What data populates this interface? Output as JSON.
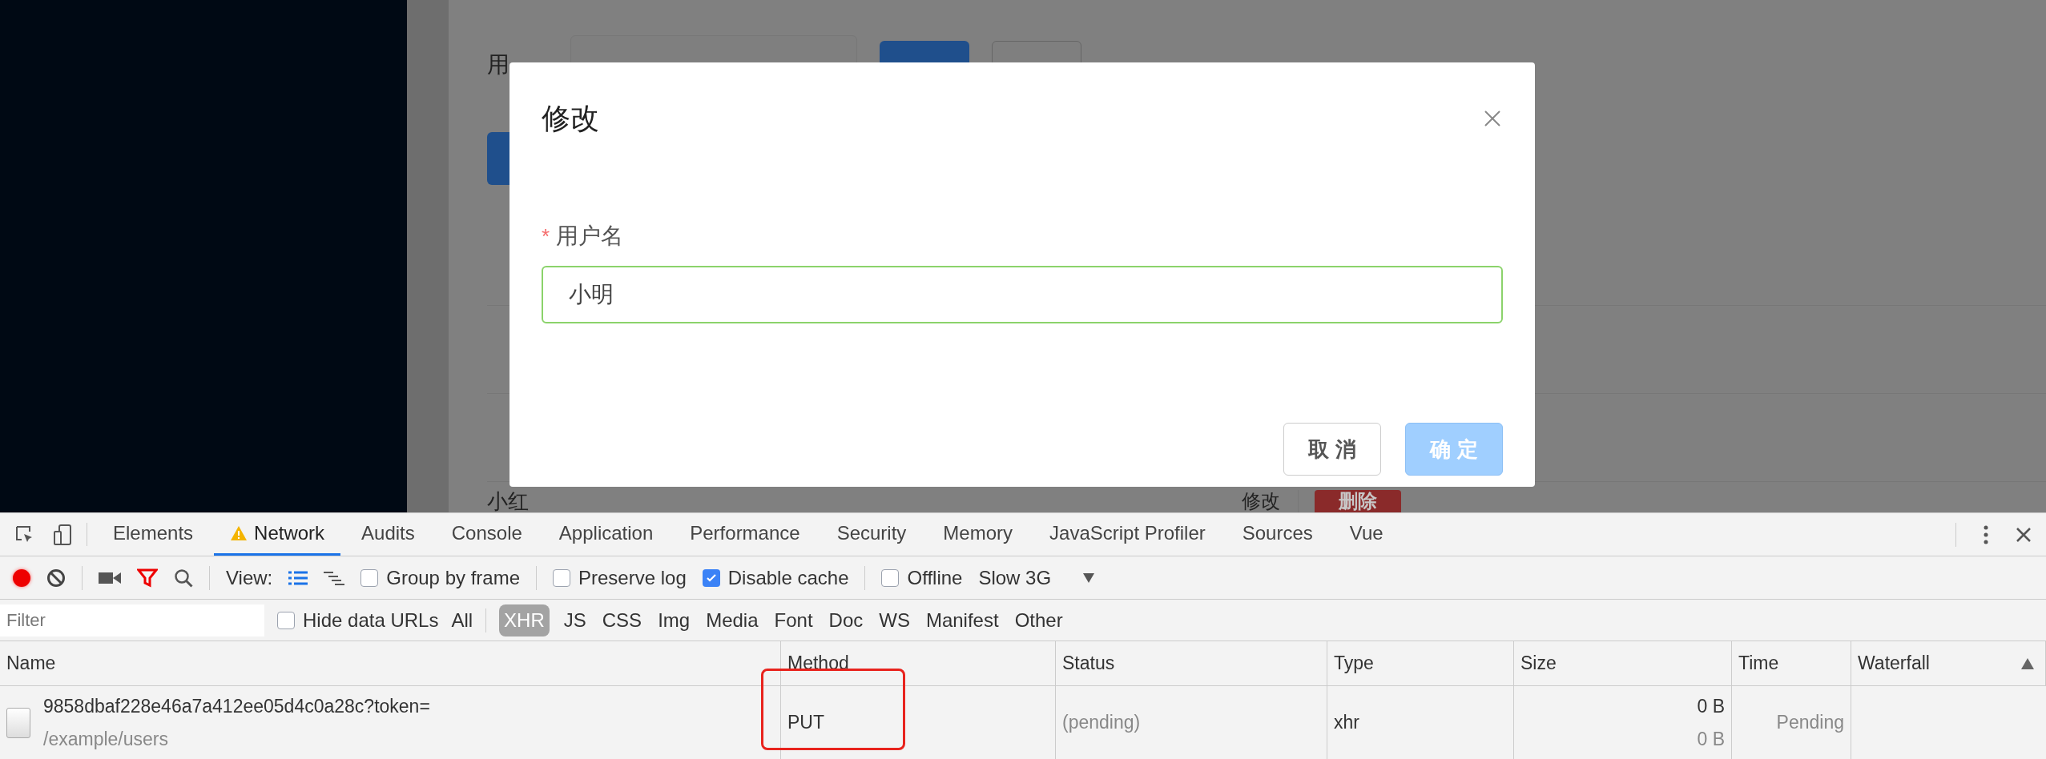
{
  "page": {
    "search_label": "用",
    "table_rows": [
      {
        "name": "小红",
        "actions": [
          {
            "label": "修改",
            "kind": "plain"
          },
          {
            "label": "删除",
            "kind": "danger"
          }
        ]
      }
    ]
  },
  "dialog": {
    "title": "修改",
    "field": {
      "label": "用户名",
      "required_mark": "*",
      "value": "小明"
    },
    "buttons": [
      {
        "label": "取 消",
        "kind": "default"
      },
      {
        "label": "确 定",
        "kind": "primary"
      }
    ]
  },
  "devtools": {
    "tabs": [
      {
        "label": "Elements",
        "selected": false,
        "warning": false
      },
      {
        "label": "Network",
        "selected": true,
        "warning": true
      },
      {
        "label": "Audits",
        "selected": false,
        "warning": false
      },
      {
        "label": "Console",
        "selected": false,
        "warning": false
      },
      {
        "label": "Application",
        "selected": false,
        "warning": false
      },
      {
        "label": "Performance",
        "selected": false,
        "warning": false
      },
      {
        "label": "Security",
        "selected": false,
        "warning": false
      },
      {
        "label": "Memory",
        "selected": false,
        "warning": false
      },
      {
        "label": "JavaScript Profiler",
        "selected": false,
        "warning": false
      },
      {
        "label": "Sources",
        "selected": false,
        "warning": false
      },
      {
        "label": "Vue",
        "selected": false,
        "warning": false
      }
    ],
    "toolbar": {
      "recording": true,
      "view_label": "View:",
      "options": [
        {
          "label": "Group by frame",
          "checked": false
        },
        {
          "label": "Preserve log",
          "checked": false
        },
        {
          "label": "Disable cache",
          "checked": true
        },
        {
          "label": "Offline",
          "checked": false
        }
      ],
      "throttle": "Slow 3G"
    },
    "filter": {
      "placeholder": "Filter",
      "hide_data_urls": {
        "label": "Hide data URLs",
        "checked": false
      },
      "all": "All",
      "types": [
        {
          "label": "XHR",
          "selected": true
        },
        {
          "label": "JS",
          "selected": false
        },
        {
          "label": "CSS",
          "selected": false
        },
        {
          "label": "Img",
          "selected": false
        },
        {
          "label": "Media",
          "selected": false
        },
        {
          "label": "Font",
          "selected": false
        },
        {
          "label": "Doc",
          "selected": false
        },
        {
          "label": "WS",
          "selected": false
        },
        {
          "label": "Manifest",
          "selected": false
        },
        {
          "label": "Other",
          "selected": false
        }
      ]
    },
    "table": {
      "columns": [
        "Name",
        "Method",
        "Status",
        "Type",
        "Size",
        "Time",
        "Waterfall"
      ],
      "rows": [
        {
          "name": "9858dbaf228e46a7a412ee05d4c0a28c?token=",
          "path": "/example/users",
          "method": "PUT",
          "method_highlighted": true,
          "status": "(pending)",
          "type": "xhr",
          "size": "0 B",
          "size_2": "0 B",
          "time": "Pending"
        }
      ]
    }
  }
}
